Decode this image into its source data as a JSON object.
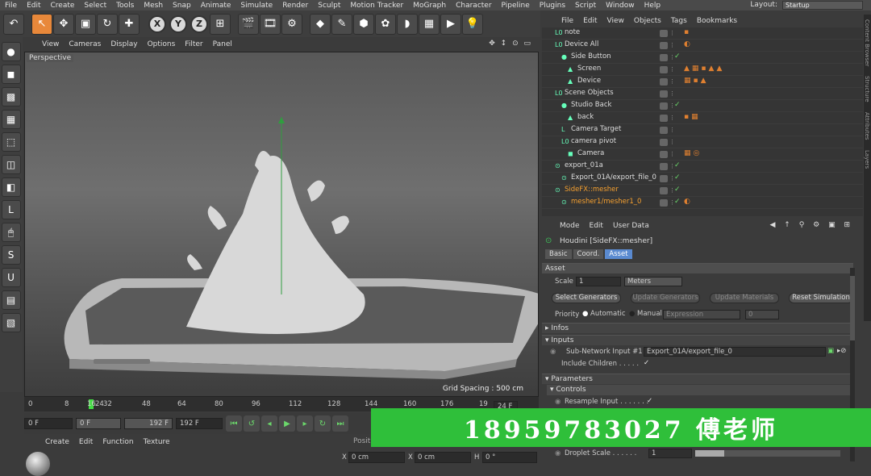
{
  "menubar": {
    "items": [
      "File",
      "Edit",
      "Create",
      "Select",
      "Tools",
      "Mesh",
      "Snap",
      "Animate",
      "Simulate",
      "Render",
      "Sculpt",
      "Motion Tracker",
      "MoGraph",
      "Character",
      "Pipeline",
      "Plugins",
      "Script",
      "Window",
      "Help"
    ],
    "layout_label": "Layout:",
    "layout_value": "Startup"
  },
  "viewport": {
    "menu": [
      "View",
      "Cameras",
      "Display",
      "Options",
      "Filter",
      "Panel"
    ],
    "label": "Perspective",
    "grid_spacing": "Grid Spacing : 500 cm"
  },
  "timeline": {
    "ticks": [
      "0",
      "8",
      "16",
      "24",
      "32",
      "48",
      "64",
      "80",
      "96",
      "112",
      "128",
      "144",
      "160",
      "176",
      "19"
    ],
    "end_field": "24 F"
  },
  "transport": {
    "start": "0 F",
    "range_start": "0 F",
    "range_end": "192 F",
    "end": "192 F"
  },
  "material_menu": [
    "Create",
    "Edit",
    "Function",
    "Texture"
  ],
  "coords": {
    "position_header": "Position",
    "x_pos": "0 cm",
    "x_size": "0 cm",
    "h_rot": "0 °",
    "x": "X",
    "h": "H"
  },
  "object_manager": {
    "menu": [
      "File",
      "Edit",
      "View",
      "Objects",
      "Tags",
      "Bookmarks"
    ],
    "rows": [
      {
        "name": "note",
        "indent": 1,
        "icon": "L0",
        "check": "",
        "tags": "▪",
        "selected": false
      },
      {
        "name": "Device All",
        "indent": 1,
        "icon": "L0",
        "check": "",
        "tags": "◐",
        "selected": false
      },
      {
        "name": "Side Button",
        "indent": 2,
        "icon": "●",
        "check": "✓",
        "tags": "",
        "selected": false
      },
      {
        "name": "Screen",
        "indent": 3,
        "icon": "▲",
        "check": "",
        "tags": "▲▦▪▲▲",
        "selected": false
      },
      {
        "name": "Device",
        "indent": 3,
        "icon": "▲",
        "check": "",
        "tags": "▦▪▲",
        "selected": false
      },
      {
        "name": "Scene Objects",
        "indent": 1,
        "icon": "L0",
        "check": "",
        "tags": "",
        "selected": false
      },
      {
        "name": "Studio Back",
        "indent": 2,
        "icon": "●",
        "check": "✓",
        "tags": "",
        "selected": false
      },
      {
        "name": "back",
        "indent": 3,
        "icon": "▲",
        "check": "",
        "tags": "▪▦",
        "selected": false
      },
      {
        "name": "Camera Target",
        "indent": 2,
        "icon": "L",
        "check": "",
        "tags": "",
        "selected": false
      },
      {
        "name": "camera pivot",
        "indent": 2,
        "icon": "L0",
        "check": "",
        "tags": "",
        "selected": false
      },
      {
        "name": "Camera",
        "indent": 3,
        "icon": "◼",
        "check": "",
        "tags": "▦◎",
        "selected": false
      },
      {
        "name": "export_01a",
        "indent": 1,
        "icon": "⊙",
        "check": "✓",
        "tags": "",
        "selected": false
      },
      {
        "name": "Export_01A/export_file_0",
        "indent": 2,
        "icon": "⊙",
        "check": "✓",
        "tags": "",
        "selected": false
      },
      {
        "name": "SideFX::mesher",
        "indent": 1,
        "icon": "⊙",
        "check": "✓",
        "tags": "",
        "selected": true
      },
      {
        "name": "mesher1/mesher1_0",
        "indent": 2,
        "icon": "⊙",
        "check": "✓",
        "tags": "◐",
        "selected": true
      }
    ]
  },
  "right_strip": [
    "Content Browser",
    "Structure",
    "Attributes",
    "Layers"
  ],
  "attribute_manager": {
    "menu": [
      "Mode",
      "Edit",
      "User Data"
    ],
    "title": "Houdini [SideFX::mesher]",
    "tabs": [
      {
        "label": "Basic",
        "active": false
      },
      {
        "label": "Coord.",
        "active": false
      },
      {
        "label": "Asset",
        "active": true
      }
    ],
    "asset_header": "Asset",
    "scale_label": "Scale",
    "scale_value": "1",
    "units_value": "Meters",
    "buttons": {
      "select_generators": "Select Generators",
      "update_generators": "Update Generators",
      "update_materials": "Update Materials",
      "reset_simulation": "Reset Simulation"
    },
    "priority_label": "Priority",
    "priority_automatic": "Automatic",
    "priority_manual": "Manual",
    "priority_expression": "Expression",
    "priority_value": "0",
    "infos": "Infos",
    "inputs": "Inputs",
    "subnet_input_label": "Sub-Network Input #1",
    "subnet_input_value": "Export_01A/export_file_0",
    "include_children_label": "Include Children . . . . .",
    "include_children_value": "✓",
    "parameters": "Parameters",
    "controls": "Controls",
    "resample_input_label": "Resample Input . . . . . . .",
    "resample_input_value": "✓",
    "droplet_scale_label": "Droplet Scale . . . . . .",
    "droplet_scale_value": "1"
  },
  "banner": {
    "text": "18959783027 傅老师"
  }
}
